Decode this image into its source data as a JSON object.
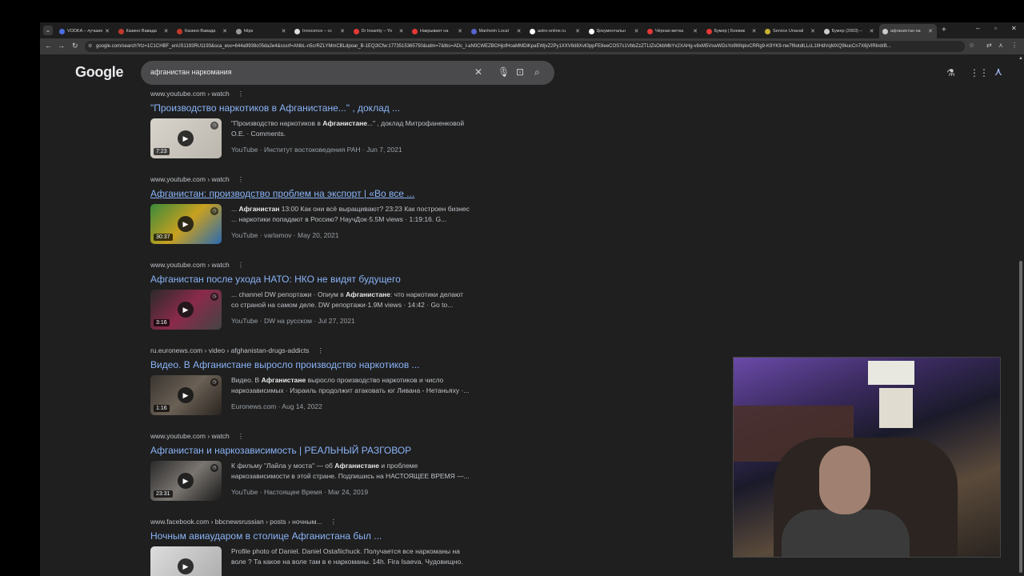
{
  "tabs": [
    {
      "label": "VODKA – лучшие",
      "color": "#4a6ee0"
    },
    {
      "label": "Казино Вавада",
      "color": "#c0392b"
    },
    {
      "label": "Казино Вавада",
      "color": "#c0392b"
    },
    {
      "label": "https",
      "color": "#999999"
    },
    {
      "label": "Innocence – cc",
      "color": "#dddddd"
    },
    {
      "label": "Dr Insanity – Yo",
      "color": "#e53935"
    },
    {
      "label": "Накрывает на",
      "color": "#e53935"
    },
    {
      "label": "Manheim Local",
      "color": "#5566cc"
    },
    {
      "label": "astro-online.ru",
      "color": "#ffffff"
    },
    {
      "label": "Документальн",
      "color": "#ffffff"
    },
    {
      "label": "Чёрная метка",
      "color": "#e53935"
    },
    {
      "label": "Бумер | Боевик",
      "color": "#e53935"
    },
    {
      "label": "Service Unavail",
      "color": "#c9b037"
    },
    {
      "label": "Бумер (2003) –",
      "color": "#cccccc"
    },
    {
      "label": "афганистан на",
      "color": "#cccccc"
    }
  ],
  "toolbar": {
    "url": "google.com/search?rlz=1C1CHBF_enUS1193RU1193&sca_esv=644a9938c05da2e4&sssrf=ANbL-n5crRZLYMmCBLdpoar_B-1EQ2lCfw:1773515365750&udm=7&tbs=ADc_I-aN0CWEZBOHjofHoaMMDiKpaEWjvZ2Py1XXV8d8Xvll3ppFE8eeCOS7s1VbbZzZTLtZsOkbMbYx2XAHg-v8xM5VswWDsYo9WtqkvCRRg9-K9YK9-nw7f6otdlLLcL1IlHdVqMXQ9kucCn7X6jVIRlndrB..."
  },
  "search": {
    "logo": "Google",
    "query": "афганистан наркомания"
  },
  "results": [
    {
      "url": "www.youtube.com › watch",
      "title": "\"Производство наркотиков в Афганистане...\" , доклад ...",
      "snippet_pre": "\"Производство наркотиков в ",
      "snippet_bold": "Афганистане",
      "snippet_post": "...\" , доклад Митрофаненковой О.Е. · Comments.",
      "source": "YouTube · Институт востоковедения РАН · Jun 7, 2021",
      "duration": "7:23",
      "thumb": "linear-gradient(135deg,#d8d4cc,#bbb6ad)",
      "underline": false
    },
    {
      "url": "www.youtube.com › watch",
      "title": "Афганистан: производство проблем на экспорт | «Во все ...",
      "snippet_pre": "... ",
      "snippet_bold": "Афганистан",
      "snippet_post": " 13:00 Как они всё выращивают? 23:23 Как построен бизнес ... наркотики попадают в Россию? НаучДок·5.5M views · 1:19:16. G...",
      "source": "YouTube · varlamov · May 20, 2021",
      "duration": "30:37",
      "thumb": "linear-gradient(135deg,#3a8a3a,#c9a020,#2a6ab0)",
      "underline": true
    },
    {
      "url": "www.youtube.com › watch",
      "title": "Афганистан после ухода НАТО: НКО не видят будущего",
      "snippet_pre": "... channel DW репортажи · Опиум в ",
      "snippet_bold": "Афганистане",
      "snippet_post": ": что наркотики делают со страной на самом деле. DW репортажи·1.9M views · 14:42 · Go to...",
      "source": "YouTube · DW на русском · Jul 27, 2021",
      "duration": "3:16",
      "thumb": "linear-gradient(135deg,#2a2a2a,#8a2a4a,#444)",
      "underline": false
    },
    {
      "url": "ru.euronews.com › video › afghanistan-drugs-addicts",
      "title": "Видео. В Афганистане выросло производство наркотиков ...",
      "snippet_pre": "Видео. В ",
      "snippet_bold": "Афганистане",
      "snippet_post": " выросло производство наркотиков и число наркозависимых · Израиль продолжит атаковать юг Ливана - Нетаньяху ·...",
      "source": "Euronews.com · Aug 14, 2022",
      "duration": "1:16",
      "thumb": "linear-gradient(135deg,#3a3530,#6a6055,#2a2520)",
      "underline": false
    },
    {
      "url": "www.youtube.com › watch",
      "title": "Афганистан и наркозависимость | РЕАЛЬНЫЙ РАЗГОВОР",
      "snippet_pre": "К фильму \"Лайла у моста\" — об ",
      "snippet_bold": "Афганистане",
      "snippet_post": " и проблеме наркозависимости в этой стране. Подпишись на НАСТОЯЩЕЕ ВРЕМЯ —...",
      "source": "YouTube · Настоящее Время · Mar 24, 2019",
      "duration": "23:31",
      "thumb": "linear-gradient(135deg,#2a2a2a,#7a7570,#1a1a1a)",
      "underline": false
    },
    {
      "url": "www.facebook.com › bbcnewsrussian › posts › ночным...",
      "title": "Ночным авиаударом в столице Афганистана был ...",
      "snippet_pre": "Profile photo of Daniel. Daniel Ostafiichuck. Получается все наркоманы на воле ? Та какое на воле там в е наркоманы. 14h. Fira Isaeva. Чудовищно.",
      "snippet_bold": "",
      "snippet_post": "",
      "source": "",
      "duration": "",
      "thumb": "linear-gradient(135deg,#ddd,#aaa)",
      "underline": false
    }
  ]
}
